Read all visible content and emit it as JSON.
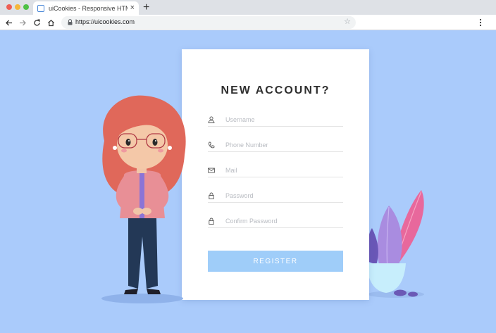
{
  "browser": {
    "tab_title": "uiCookies - Responsive HTML",
    "url": "https://uicookies.com",
    "traffic_lights": [
      "#ee5f55",
      "#f5b73a",
      "#4ec146"
    ]
  },
  "form": {
    "title": "NEW ACCOUNT?",
    "fields": [
      {
        "icon": "user-icon",
        "placeholder": "Username"
      },
      {
        "icon": "phone-icon",
        "placeholder": "Phone Number"
      },
      {
        "icon": "mail-icon",
        "placeholder": "Mail"
      },
      {
        "icon": "lock-icon",
        "placeholder": "Password"
      },
      {
        "icon": "lock-icon",
        "placeholder": "Confirm Password"
      }
    ],
    "submit_label": "REGISTER"
  },
  "colors": {
    "page_background": "#aacbfb",
    "button": "#9fcdf9",
    "card": "#ffffff"
  }
}
